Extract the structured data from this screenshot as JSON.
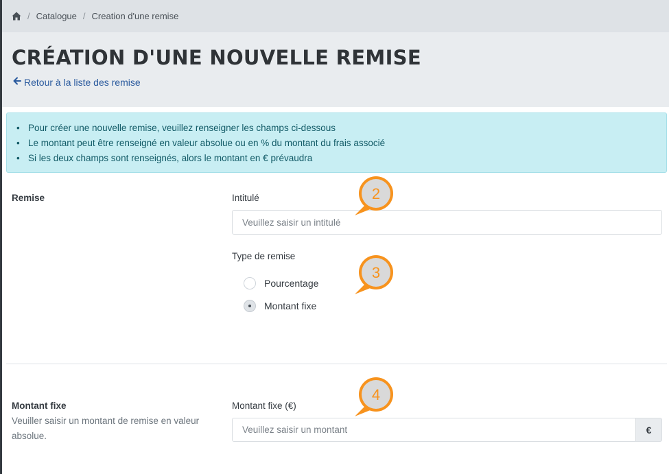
{
  "breadcrumb": {
    "home_icon": "home-icon",
    "separator": "/",
    "items": [
      "Catalogue",
      "Creation d'une remise"
    ]
  },
  "header": {
    "title": "CRÉATION D'UNE NOUVELLE REMISE",
    "back_link": "Retour à la liste des remise",
    "back_icon": "arrow-left-icon"
  },
  "info": {
    "items": [
      "Pour créer une nouvelle remise, veuillez renseigner les champs ci-dessous",
      "Le montant peut être renseigné en valeur absolue ou en % du montant du frais associé",
      "Si les deux champs sont renseignés, alors le montant en € prévaudra"
    ]
  },
  "remise_section": {
    "label": "Remise",
    "intitule_label": "Intitulé",
    "intitule_placeholder": "Veuillez saisir un intitulé",
    "intitule_value": "",
    "type_label": "Type de remise",
    "options": [
      {
        "label": "Pourcentage",
        "checked": false
      },
      {
        "label": "Montant fixe",
        "checked": true
      }
    ]
  },
  "montant_section": {
    "label": "Montant fixe",
    "help": "Veuiller saisir un montant de remise en valeur absolue.",
    "field_label": "Montant fixe (€)",
    "placeholder": "Veuillez saisir un montant",
    "value": "",
    "addon": "€"
  },
  "callouts": [
    "2",
    "3",
    "4"
  ],
  "colors": {
    "callout_fill": "#d9d9d9",
    "callout_stroke": "#f7931e",
    "info_bg": "#c8eef3",
    "link": "#2a5a9e"
  }
}
